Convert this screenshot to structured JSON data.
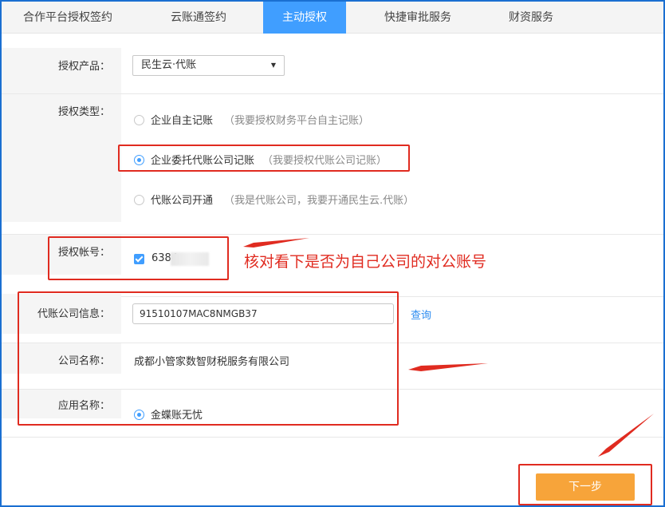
{
  "tabs": [
    {
      "label": "合作平台授权签约"
    },
    {
      "label": "云账通签约"
    },
    {
      "label": "主动授权"
    },
    {
      "label": "快捷审批服务"
    },
    {
      "label": "财资服务"
    }
  ],
  "form": {
    "product_label": "授权产品：",
    "product_value": "民生云·代账",
    "type_label": "授权类型：",
    "options": [
      {
        "text": "企业自主记账",
        "hint": "（我要授权财务平台自主记账）",
        "selected": false
      },
      {
        "text": "企业委托代账公司记账",
        "hint": "（我要授权代账公司记账）",
        "selected": true
      },
      {
        "text": "代账公司开通",
        "hint": "（我是代账公司，我要开通民生云.代账）",
        "selected": false
      }
    ],
    "account_label": "授权帐号：",
    "account_value": "6384",
    "agency_label": "代账公司信息：",
    "agency_value": "91510107MAC8NMGB37",
    "query_link": "查询",
    "company_label": "公司名称：",
    "company_value": "成都小管家数智财税服务有限公司",
    "app_label": "应用名称：",
    "app_value": "金蝶账无忧"
  },
  "annotation": {
    "text": "核对看下是否为自己公司的对公账号",
    "color": "#e02b20"
  },
  "next_button": "下一步",
  "colors": {
    "accent": "#409eff",
    "button": "#f7a43a",
    "annotation": "#e02b20"
  }
}
